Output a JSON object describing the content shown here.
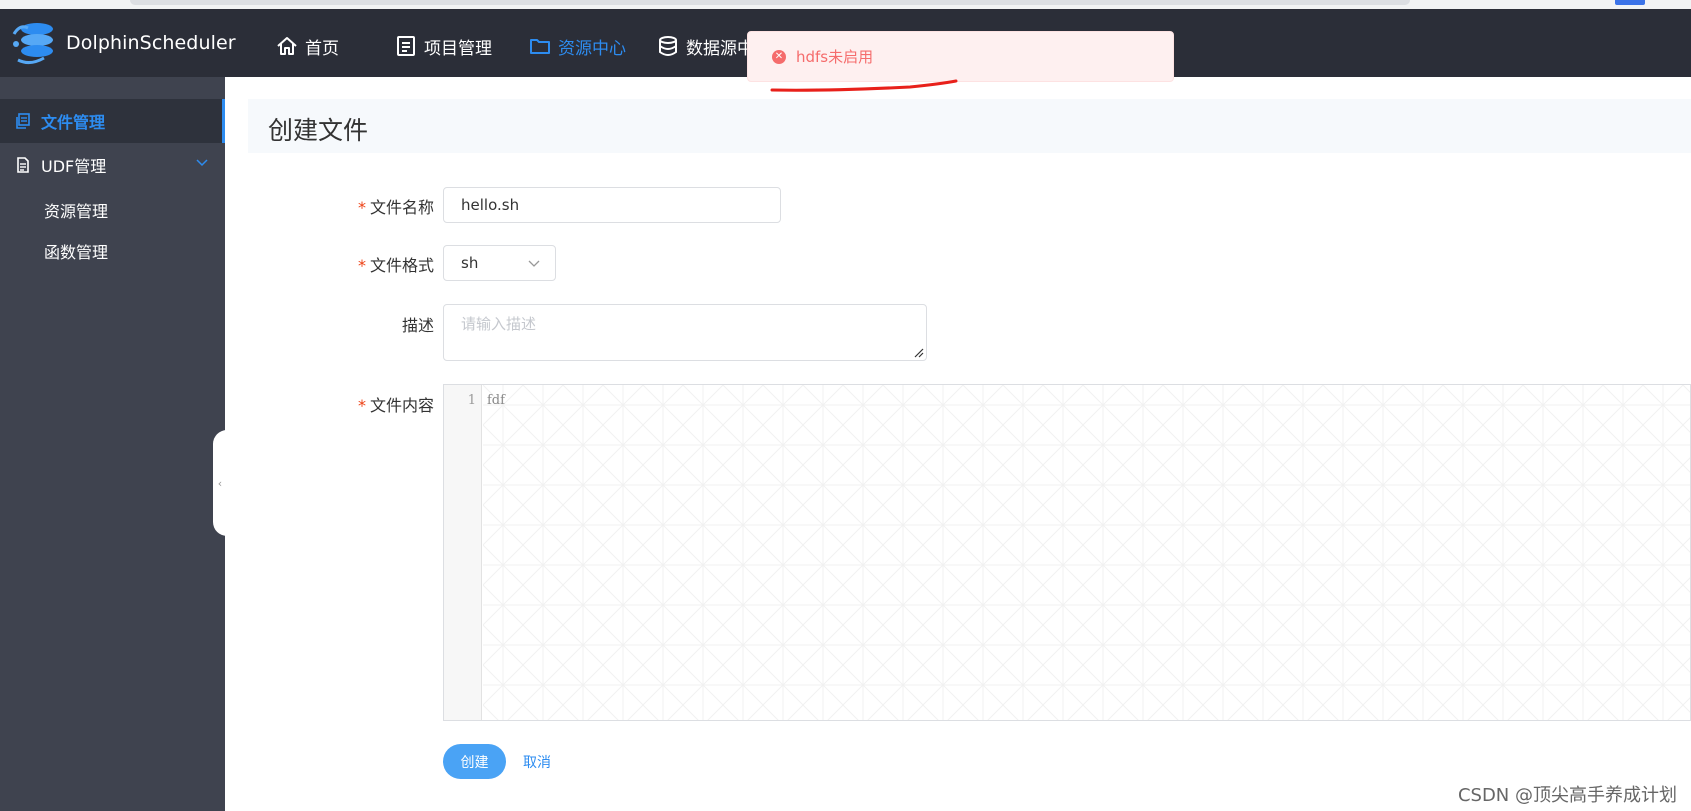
{
  "app": {
    "name": "DolphinScheduler"
  },
  "nav": {
    "items": [
      {
        "label": "首页",
        "icon": "home-icon"
      },
      {
        "label": "项目管理",
        "icon": "document-icon"
      },
      {
        "label": "资源中心",
        "icon": "folder-icon",
        "active": true
      },
      {
        "label": "数据源中",
        "icon": "database-icon"
      }
    ]
  },
  "toast": {
    "type": "error",
    "message": "hdfs未启用",
    "color": "#f56c6c"
  },
  "sidebar": {
    "items": [
      {
        "label": "文件管理",
        "icon": "files-icon",
        "active": true
      },
      {
        "label": "UDF管理",
        "icon": "doc-icon",
        "expanded": true
      }
    ],
    "sub_items": [
      {
        "label": "资源管理"
      },
      {
        "label": "函数管理"
      }
    ]
  },
  "page": {
    "title": "创建文件"
  },
  "form": {
    "file_name": {
      "label": "文件名称",
      "required": true,
      "value": "hello.sh"
    },
    "file_format": {
      "label": "文件格式",
      "required": true,
      "value": "sh"
    },
    "description": {
      "label": "描述",
      "placeholder": "请输入描述",
      "value": ""
    },
    "file_content": {
      "label": "文件内容",
      "required": true,
      "lines": [
        {
          "number": "1",
          "text": "fdf"
        }
      ]
    },
    "create_label": "创建",
    "cancel_label": "取消"
  },
  "watermark": "CSDN @顶尖高手养成计划",
  "colors": {
    "header_bg": "#2b2e38",
    "sidebar_bg": "#3f434f",
    "accent": "#2d8cf0",
    "required": "#ed4014"
  }
}
